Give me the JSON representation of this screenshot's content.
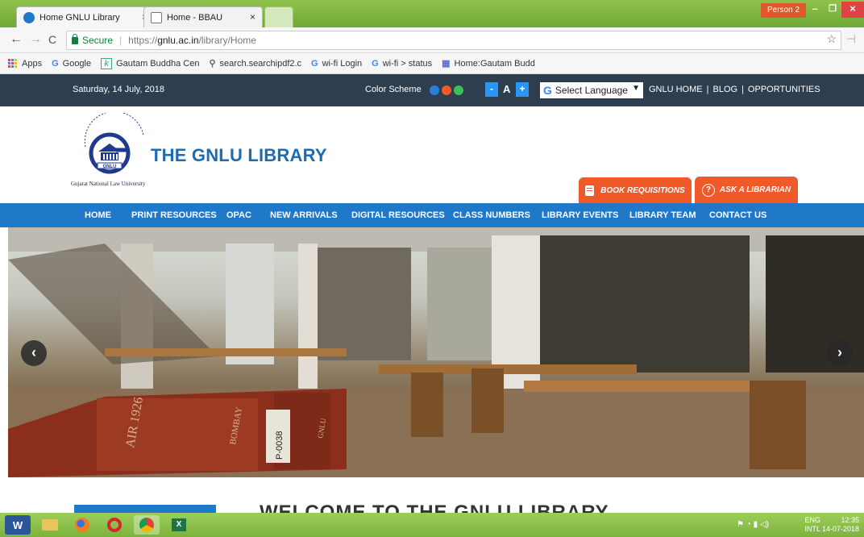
{
  "browser": {
    "tabs": [
      {
        "title": "Home GNLU Library",
        "active": true
      },
      {
        "title": "Home - BBAU",
        "active": false
      }
    ],
    "tab_close": "×",
    "person": "Person 2",
    "window_controls": {
      "minimize": "–",
      "maximize": "❐",
      "close": "×"
    },
    "nav": {
      "back": "←",
      "forward": "→",
      "reload": "C"
    },
    "address": {
      "secure_label": "Secure",
      "url_prefix": "https://",
      "url_host": "gnlu.ac.in",
      "url_path": "/library/Home"
    },
    "bookmark_star": "☆",
    "bookmarks": [
      {
        "label": "Apps",
        "icon": "apps-grid-icon"
      },
      {
        "label": "Google",
        "icon": "google-g-icon"
      },
      {
        "label": "Gautam Buddha Cen",
        "icon": "k-icon"
      },
      {
        "label": "search.searchipdf2.c",
        "icon": "search-icon"
      },
      {
        "label": "wi-fi Login",
        "icon": "google-g-icon"
      },
      {
        "label": "wi-fi > status",
        "icon": "google-g-icon"
      },
      {
        "label": "Home:Gautam Budd",
        "icon": "site-icon"
      }
    ]
  },
  "topbar": {
    "date": "Saturday, 14 July, 2018",
    "color_scheme_label": "Color Scheme",
    "scheme_colors": [
      "#2a7fd8",
      "#f05a28",
      "#3fbf5a"
    ],
    "font_decrease": "-",
    "font_label": "A",
    "font_increase": "+",
    "select_language": "Select Language",
    "select_caret": "▼",
    "links": [
      "GNLU HOME",
      "BLOG",
      "OPPORTUNITIES"
    ],
    "separator": "|"
  },
  "header": {
    "site_title": "THE GNLU LIBRARY",
    "logo_caption": "Gujarat National Law University",
    "logo_text": "GNLU",
    "book_requisitions": "BOOK REQUISITIONS",
    "ask_librarian": "ASK A LIBRARIAN",
    "ask_icon_glyph": "?"
  },
  "main_nav": [
    "HOME",
    "PRINT RESOURCES",
    "OPAC",
    "NEW ARRIVALS",
    "DIGITAL RESOURCES",
    "CLASS NUMBERS",
    "LIBRARY EVENTS",
    "LIBRARY TEAM",
    "CONTACT US"
  ],
  "slider": {
    "prev": "‹",
    "next": "›",
    "book_spine": {
      "text1": "AIR 1926",
      "text2": "BOMBAY",
      "text3": "P-0038",
      "text4": "GNLU"
    }
  },
  "welcome_heading": "WELCOME TO THE GNLU LIBRARY",
  "taskbar": {
    "language": "ENG",
    "layout": "INTL",
    "time": "12:35",
    "date": "14-07-2018"
  },
  "colors": {
    "accent_blue": "#1f78c8",
    "accent_orange": "#f05a28",
    "topbar_bg": "#2e3e4e",
    "title_blue": "#1b6cb5"
  }
}
